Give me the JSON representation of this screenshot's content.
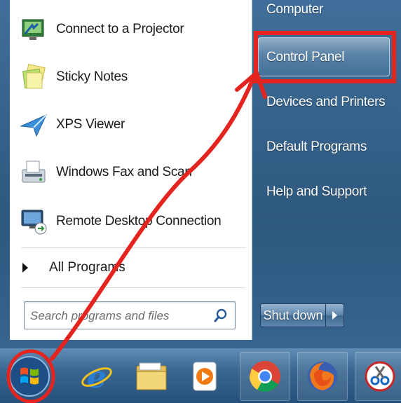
{
  "start_menu": {
    "programs": [
      {
        "label": "Connect to a Projector",
        "icon": "projector-icon"
      },
      {
        "label": "Sticky Notes",
        "icon": "sticky-notes-icon"
      },
      {
        "label": "XPS Viewer",
        "icon": "xps-viewer-icon"
      },
      {
        "label": "Windows Fax and Scan",
        "icon": "fax-scan-icon"
      },
      {
        "label": "Remote Desktop Connection",
        "icon": "remote-desktop-icon"
      }
    ],
    "all_programs_label": "All Programs",
    "search": {
      "placeholder": "Search programs and files",
      "value": ""
    },
    "right_items": [
      {
        "label": "Computer"
      },
      {
        "label": "Control Panel"
      },
      {
        "label": "Devices and Printers"
      },
      {
        "label": "Default Programs"
      },
      {
        "label": "Help and Support"
      }
    ],
    "shutdown_label": "Shut down"
  },
  "taskbar": {
    "items": [
      {
        "icon": "start-orb-icon"
      },
      {
        "icon": "internet-explorer-icon"
      },
      {
        "icon": "file-explorer-icon"
      },
      {
        "icon": "media-player-icon"
      },
      {
        "icon": "chrome-icon"
      },
      {
        "icon": "firefox-icon"
      },
      {
        "icon": "snipping-tool-icon"
      }
    ]
  },
  "colors": {
    "annotation_red": "#e3241f",
    "menu_blue": "#2d587f"
  }
}
